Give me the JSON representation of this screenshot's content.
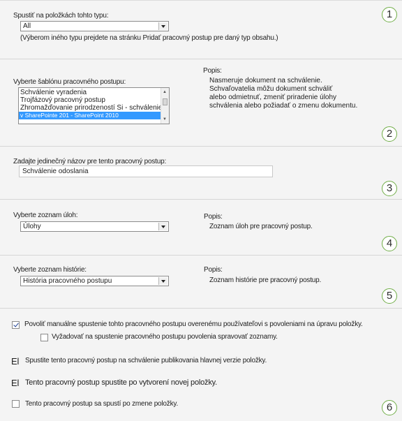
{
  "section1": {
    "number": "1",
    "label": "Spustiť na položkách tohto typu:",
    "select_value": "All",
    "hint": "(Výberom iného typu prejdete na stránku Pridať pracovný postup pre daný typ obsahu.)"
  },
  "section2": {
    "number": "2",
    "label": "Vyberte šablónu pracovného postupu:",
    "templates": [
      "Schválenie vyradenia",
      "Trojfázový pracovný postup",
      "Zhromažďovanie prirodzeností Si - schválenie",
      "v SharePointe 201 - SharePoint 2010"
    ],
    "selected_index": 3,
    "desc_label": "Popis:",
    "desc_lines": [
      "Nasmeruje dokument na schválenie.",
      "Schvaľovatelia môžu dokument schváliť",
      "alebo odmietnuť, zmeniť priradenie úlohy",
      "schválenia alebo požiadať o zmenu dokumentu."
    ]
  },
  "section3": {
    "number": "3",
    "label": "Zadajte jedinečný názov pre tento pracovný postup:",
    "name_value": "Schválenie odoslania"
  },
  "section4": {
    "number": "4",
    "label": "Vyberte zoznam úloh:",
    "select_value": "Úlohy",
    "desc_label": "Popis:",
    "desc": "Zoznam úloh pre pracovný postup."
  },
  "section5": {
    "number": "5",
    "label": "Vyberte zoznam histórie:",
    "select_value": "História pracovného postupu",
    "desc_label": "Popis:",
    "desc": "Zoznam histórie pre pracovný postup."
  },
  "section6": {
    "number": "6",
    "opt_manual": "Povoliť manuálne spustenie tohto pracovného postupu overenému používateľovi s povoleniami na úpravu položky.",
    "opt_manual_checked": true,
    "opt_manage": "Vyžadovať na spustenie pracovného postupu povolenia spravovať zoznamy.",
    "opt_manage_checked": false,
    "marker_a": "El",
    "opt_publish": "Spustite tento pracovný postup na schválenie publikovania hlavnej verzie položky.",
    "marker_b": "El",
    "opt_create": "Tento pracovný postup spustite po vytvorení novej položky.",
    "opt_change": "Tento pracovný postup sa spustí po zmene položky.",
    "opt_change_checked": false
  }
}
